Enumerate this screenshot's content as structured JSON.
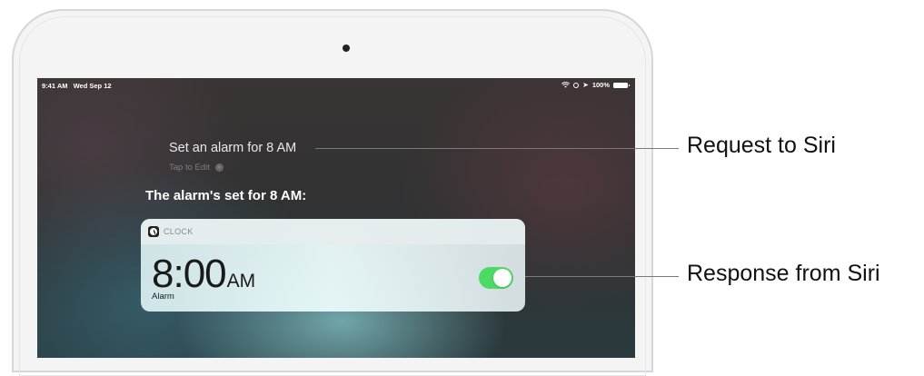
{
  "status_bar": {
    "time": "9:41 AM",
    "date": "Wed Sep 12",
    "battery": "100%"
  },
  "siri": {
    "request": "Set an alarm for 8 AM",
    "tap_to_edit": "Tap to Edit",
    "response": "The alarm's set for 8 AM:"
  },
  "card": {
    "app_name": "CLOCK",
    "time": "8:00",
    "ampm": "AM",
    "label": "Alarm",
    "toggle_on": true
  },
  "callouts": {
    "request": "Request to Siri",
    "response": "Response from Siri"
  },
  "colors": {
    "toggle_on": "#4cd964",
    "callout_line": "#7a7a7a"
  }
}
